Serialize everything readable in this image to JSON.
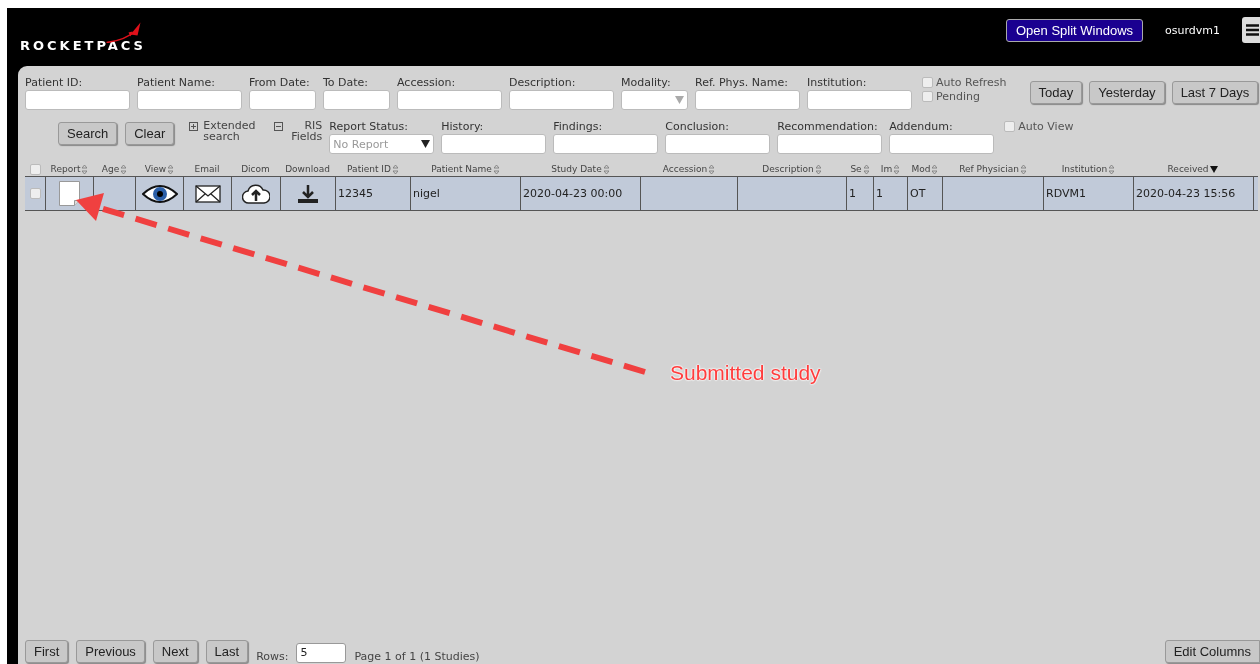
{
  "header": {
    "logo": "ROCKETPACS",
    "split_button": "Open Split Windows",
    "username": "osurdvm1"
  },
  "filters": {
    "fields": [
      {
        "label": "Patient ID:",
        "kind": "text"
      },
      {
        "label": "Patient Name:",
        "kind": "text"
      },
      {
        "label": "From Date:",
        "kind": "date"
      },
      {
        "label": "To Date:",
        "kind": "date"
      },
      {
        "label": "Accession:",
        "kind": "text"
      },
      {
        "label": "Description:",
        "kind": "text"
      },
      {
        "label": "Modality:",
        "kind": "select"
      },
      {
        "label": "Ref. Phys. Name:",
        "kind": "text"
      },
      {
        "label": "Institution:",
        "kind": "text"
      }
    ],
    "checkboxes": [
      {
        "label": "Auto Refresh",
        "checked": false
      },
      {
        "label": "Pending",
        "checked": false
      }
    ],
    "date_buttons": [
      "Today",
      "Yesterday",
      "Last 7 Days"
    ],
    "action_buttons": [
      "Search",
      "Clear"
    ],
    "toggles": [
      {
        "label": "Extended search",
        "expanded": false
      },
      {
        "label": "RIS Fields",
        "expanded": true
      }
    ],
    "report_status": {
      "label": "Report Status:",
      "value": "No Report"
    },
    "ris_fields": [
      {
        "label": "History:"
      },
      {
        "label": "Findings:"
      },
      {
        "label": "Conclusion:"
      },
      {
        "label": "Recommendation:"
      },
      {
        "label": "Addendum:"
      }
    ],
    "auto_view": {
      "label": "Auto View",
      "checked": false
    }
  },
  "table": {
    "select_all": {
      "checked": false
    },
    "columns": [
      {
        "label": "Report",
        "sortable": true,
        "sorted_descending": false
      },
      {
        "label": "Age",
        "sortable": true,
        "sorted_descending": false
      },
      {
        "label": "View",
        "sortable": true,
        "sorted_descending": false
      },
      {
        "label": "Email",
        "sortable": false
      },
      {
        "label": "Dicom",
        "sortable": false
      },
      {
        "label": "Download",
        "sortable": false
      },
      {
        "label": "Patient ID",
        "sortable": true,
        "sorted_descending": false
      },
      {
        "label": "Patient Name",
        "sortable": true,
        "sorted_descending": false
      },
      {
        "label": "Study Date",
        "sortable": true,
        "sorted_descending": false
      },
      {
        "label": "Accession",
        "sortable": true,
        "sorted_descending": false
      },
      {
        "label": "Description",
        "sortable": true,
        "sorted_descending": false
      },
      {
        "label": "Se",
        "sortable": true,
        "sorted_descending": false
      },
      {
        "label": "Im",
        "sortable": true,
        "sorted_descending": false
      },
      {
        "label": "Mod",
        "sortable": true,
        "sorted_descending": false
      },
      {
        "label": "Ref Physician",
        "sortable": true,
        "sorted_descending": false
      },
      {
        "label": "Institution",
        "sortable": true,
        "sorted_descending": false
      },
      {
        "label": "Received",
        "sortable": true,
        "sorted_descending": true
      }
    ],
    "rows": [
      {
        "checked": false,
        "selected": true,
        "patient_id": "12345",
        "patient_name": "nigel",
        "study_date": "2020-04-23 00:00",
        "se": "1",
        "im": "1",
        "mod": "OT",
        "institution": "RDVM1",
        "received": "2020-04-23 15:56"
      }
    ]
  },
  "pagination": {
    "buttons": [
      "First",
      "Previous",
      "Next",
      "Last"
    ],
    "rows_label": "Rows:",
    "rows_value": "5",
    "page_info": "Page 1 of 1 (1 Studies)",
    "edit_columns": "Edit Columns"
  },
  "annotation": {
    "text": "Submitted study"
  }
}
